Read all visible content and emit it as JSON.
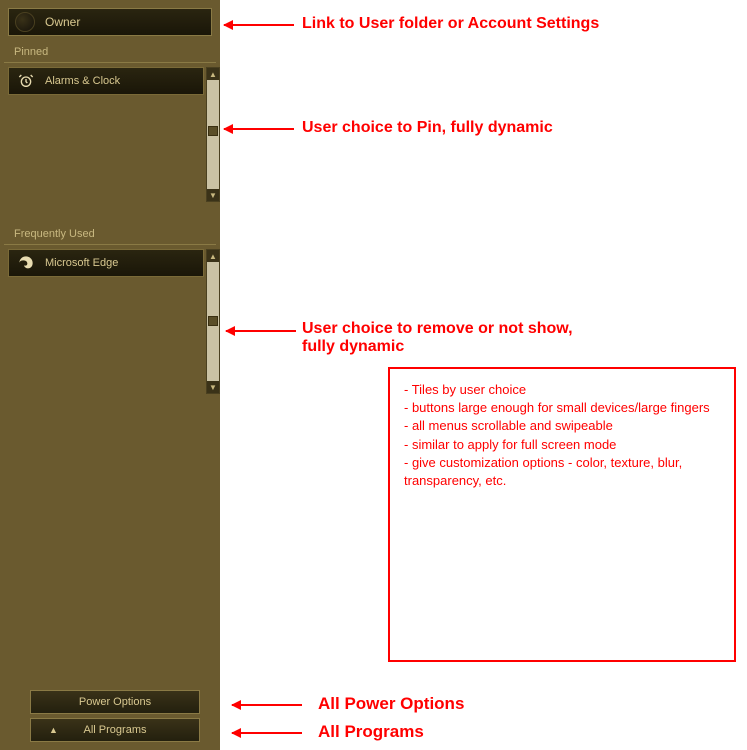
{
  "user": {
    "name": "Owner",
    "avatar_initials": ""
  },
  "sections": {
    "pinned": {
      "label": "Pinned",
      "items": [
        {
          "label": "Alarms & Clock",
          "icon": "alarm-clock"
        }
      ]
    },
    "frequent": {
      "label": "Frequently Used",
      "items": [
        {
          "label": "Microsoft Edge",
          "icon": "edge"
        }
      ]
    }
  },
  "bottom": {
    "power": "Power Options",
    "all_programs": "All Programs"
  },
  "annotations": {
    "user_link": "Link to User folder or Account Settings",
    "pin_dynamic": "User choice to Pin, fully dynamic",
    "remove_dynamic": "User choice to remove or not show,\nfully dynamic",
    "all_power": "All Power Options",
    "all_programs": "All Programs",
    "note_lines": [
      "- Tiles by user choice",
      "- buttons large enough for small devices/large fingers",
      "- all menus scrollable and swipeable",
      "",
      "- similar to apply for full screen mode",
      "",
      "- give customization options - color, texture, blur, transparency, etc."
    ]
  }
}
